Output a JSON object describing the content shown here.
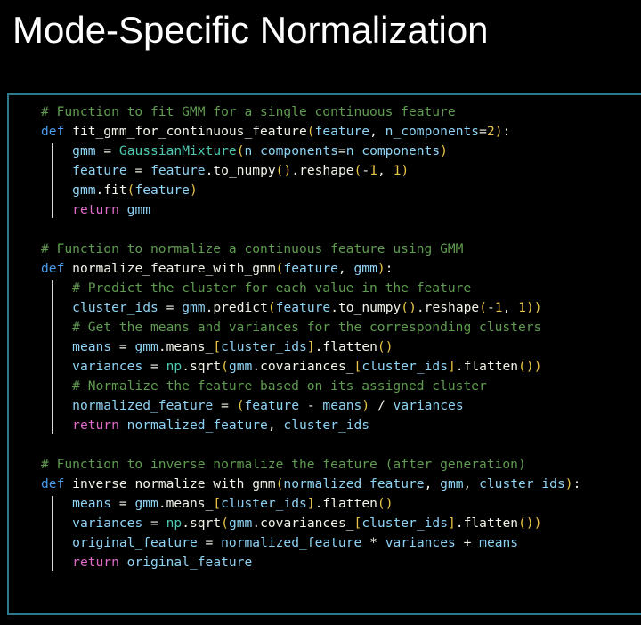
{
  "slide": {
    "title": "Mode-Specific Normalization",
    "background_color": "#000000",
    "title_color": "#ffffff"
  },
  "code_panel": {
    "border_color": "#2d7a8c",
    "background_color": "#000000",
    "language": "python",
    "theme_colors": {
      "comment": "#5f9b50",
      "keyword": "#4a9bea",
      "return_keyword": "#e06bc8",
      "function_name": "#f2f2e8",
      "type": "#4ec9b0",
      "variable": "#8fd3f4",
      "punctuation": "#e8c547",
      "number": "#e8c547",
      "plain": "#f2f2e8",
      "indent_guide": "#d8d8d8"
    },
    "lines": [
      "# Function to fit GMM for a single continuous feature",
      "def fit_gmm_for_continuous_feature(feature, n_components=2):",
      "    gmm = GaussianMixture(n_components=n_components)",
      "    feature = feature.to_numpy().reshape(-1, 1)",
      "    gmm.fit(feature)",
      "    return gmm",
      "",
      "# Function to normalize a continuous feature using GMM",
      "def normalize_feature_with_gmm(feature, gmm):",
      "    # Predict the cluster for each value in the feature",
      "    cluster_ids = gmm.predict(feature.to_numpy().reshape(-1, 1))",
      "    # Get the means and variances for the corresponding clusters",
      "    means = gmm.means_[cluster_ids].flatten()",
      "    variances = np.sqrt(gmm.covariances_[cluster_ids].flatten())",
      "    # Normalize the feature based on its assigned cluster",
      "    normalized_feature = (feature - means) / variances",
      "    return normalized_feature, cluster_ids",
      "",
      "# Function to inverse normalize the feature (after generation)",
      "def inverse_normalize_with_gmm(normalized_feature, gmm, cluster_ids):",
      "    means = gmm.means_[cluster_ids].flatten()",
      "    variances = np.sqrt(gmm.covariances_[cluster_ids].flatten())",
      "    original_feature = normalized_feature * variances + means",
      "    return original_feature"
    ],
    "functions": [
      "fit_gmm_for_continuous_feature",
      "normalize_feature_with_gmm",
      "inverse_normalize_with_gmm"
    ]
  }
}
